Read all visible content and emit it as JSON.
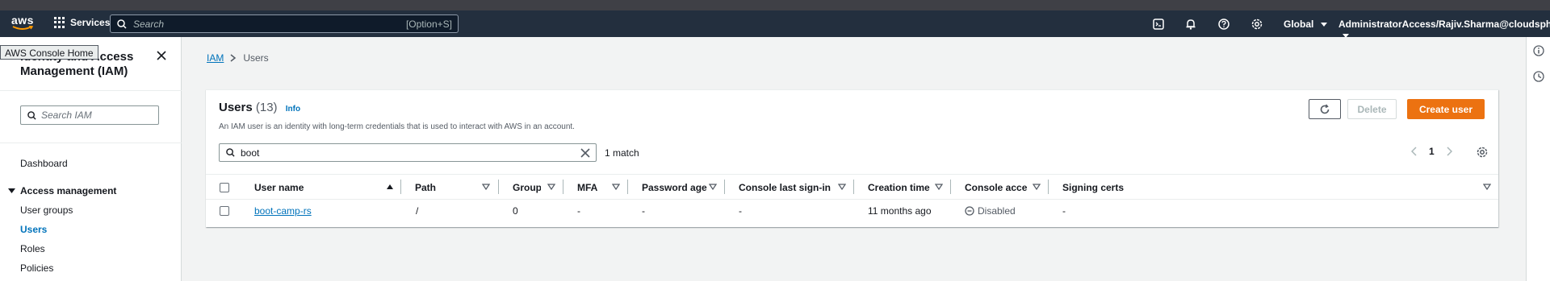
{
  "topnav": {
    "logo_text": "aws",
    "services_label": "Services",
    "search_placeholder": "Search",
    "search_shortcut": "[Option+S]",
    "region_label": "Global",
    "account_label": "AdministratorAccess/Rajiv.Sharma@cloudsphere.com"
  },
  "tooltip": {
    "text": "AWS Console Home"
  },
  "sidebar": {
    "title": "Identity and Access Management (IAM)",
    "search_placeholder": "Search IAM",
    "dashboard": "Dashboard",
    "section_access": "Access management",
    "items": [
      {
        "label": "User groups"
      },
      {
        "label": "Users"
      },
      {
        "label": "Roles"
      },
      {
        "label": "Policies"
      }
    ]
  },
  "breadcrumb": {
    "root": "IAM",
    "current": "Users"
  },
  "users_panel": {
    "title": "Users",
    "count": "(13)",
    "info": "Info",
    "description": "An IAM user is an identity with long-term credentials that is used to interact with AWS in an account.",
    "delete_label": "Delete",
    "create_label": "Create user",
    "filter_value": "boot",
    "match_text": "1 match",
    "page_number": "1"
  },
  "table": {
    "columns": [
      "User name",
      "Path",
      "Groups",
      "MFA",
      "Password age",
      "Console last sign-in",
      "Creation time",
      "Console access",
      "Signing certs"
    ],
    "rows": [
      {
        "user_name": "boot-camp-rs",
        "path": "/",
        "groups": "0",
        "mfa": "-",
        "password_age": "-",
        "console_last_sign_in": "-",
        "creation_time": "11 months ago",
        "console_access": "Disabled",
        "signing_certs": "-"
      }
    ]
  },
  "colors": {
    "nav_bg": "#232f3e",
    "primary_button": "#ec7211",
    "link": "#0073bb"
  }
}
